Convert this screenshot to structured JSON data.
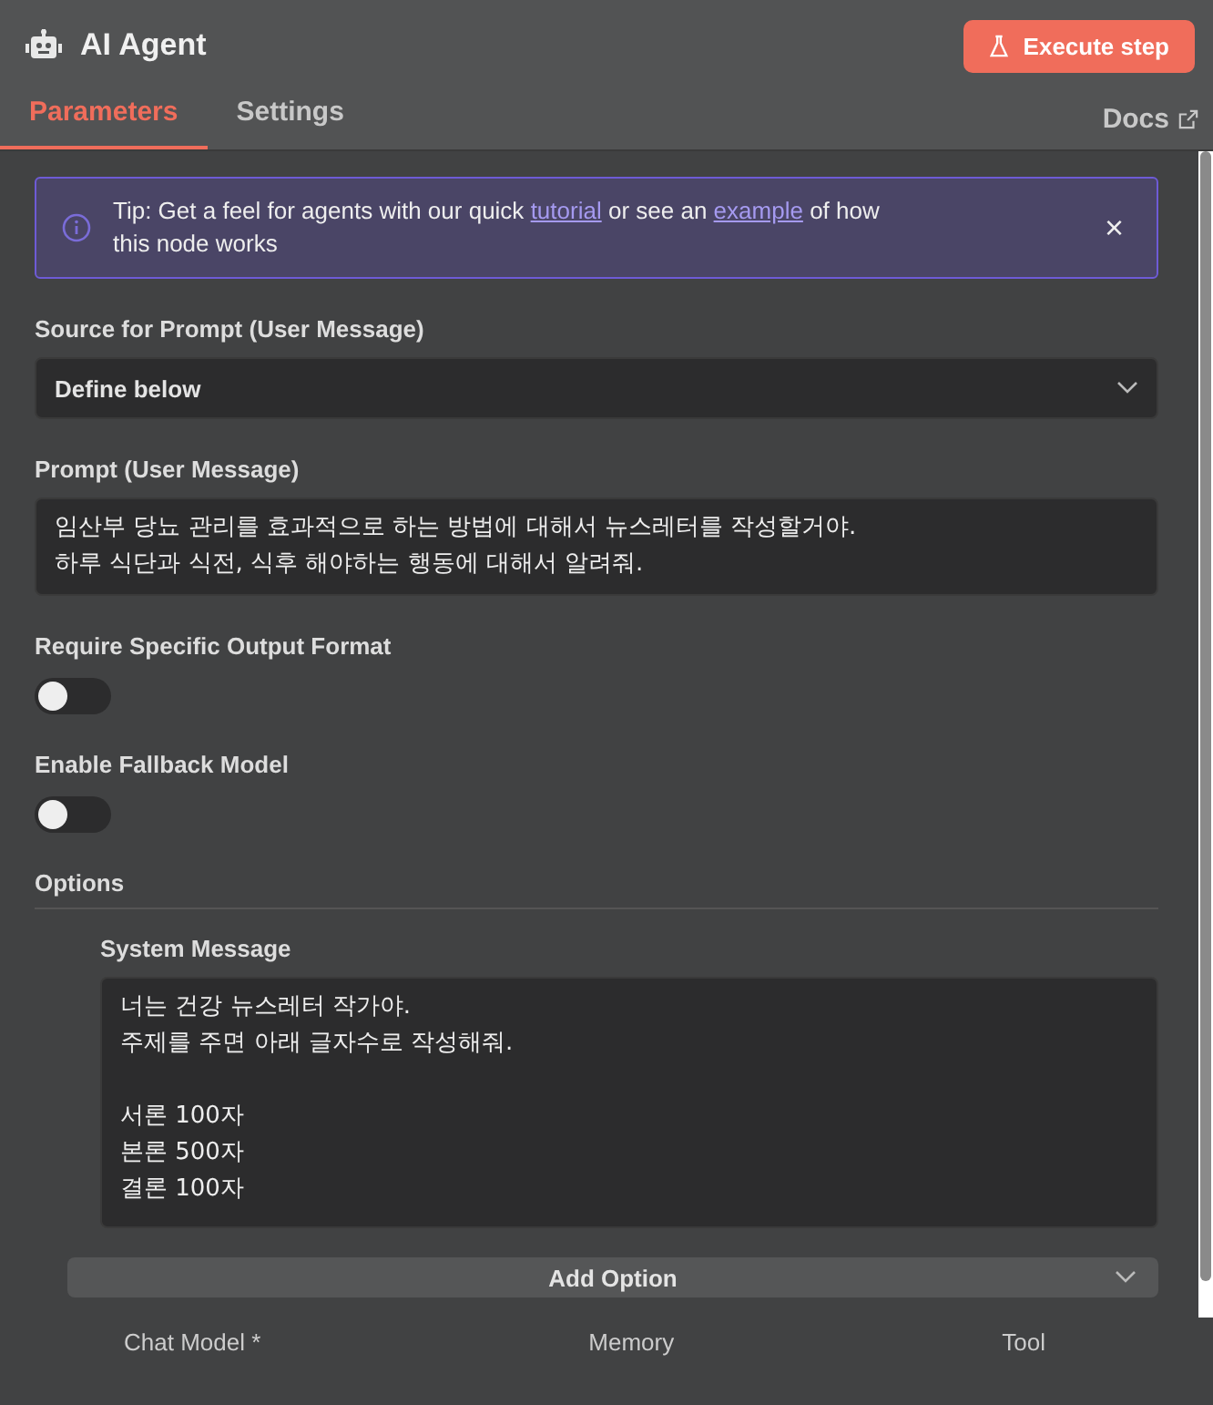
{
  "header": {
    "title": "AI Agent",
    "execute_button": "Execute step"
  },
  "tabs": [
    {
      "label": "Parameters",
      "selected": true
    },
    {
      "label": "Settings",
      "selected": false
    }
  ],
  "docs_link": "Docs",
  "tip": {
    "parts": [
      {
        "kind": "text",
        "text": "Tip: Get a feel for agents with our quick"
      },
      {
        "kind": "link",
        "text": "tutorial"
      },
      {
        "kind": "text",
        "text": "or see an"
      },
      {
        "kind": "link",
        "text": "example"
      },
      {
        "kind": "text",
        "text": "of how this node works"
      }
    ],
    "close": "×"
  },
  "fields": [
    {
      "kind": "select",
      "label": "Source for Prompt (User Message)",
      "value": "Define below"
    },
    {
      "kind": "textarea",
      "label": "Prompt (User Message)",
      "value": "임산부 당뇨 관리를 효과적으로 하는 방법에 대해서 뉴스레터를 작성할거야.\n하루 식단과 식전, 식후 해야하는 행동에 대해서 알려줘."
    },
    {
      "kind": "toggle",
      "label": "Require Specific Output Format",
      "on": false
    },
    {
      "kind": "toggle",
      "label": "Enable Fallback Model",
      "on": false
    }
  ],
  "options": {
    "title": "Options",
    "system_message": {
      "label": "System Message",
      "value": "너는 건강 뉴스레터 작가야.\n주제를 주면 아래 글자수로 작성해줘.\n\n서론 100자\n본론 500자\n결론 100자"
    },
    "add_option": "Add Option"
  },
  "connections": [
    "Chat Model *",
    "Memory",
    "Tool"
  ]
}
